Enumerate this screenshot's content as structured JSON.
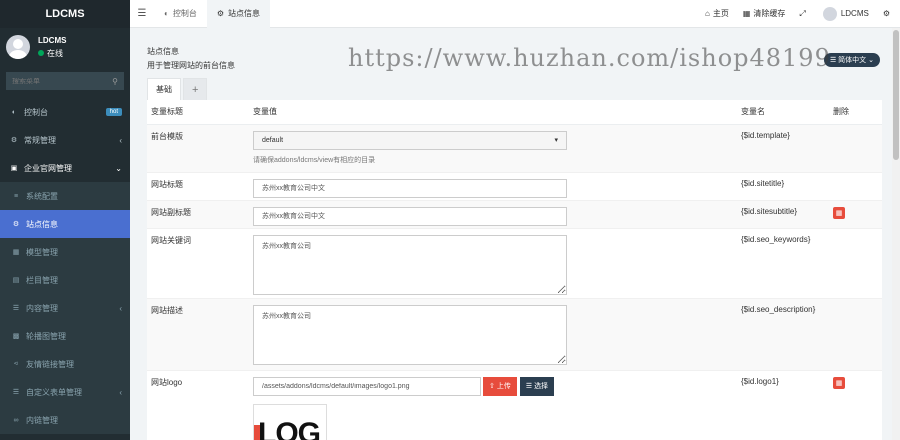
{
  "brand": "LDCMS",
  "user": {
    "name": "LDCMS",
    "status": "在线"
  },
  "search": {
    "placeholder": "搜索菜单"
  },
  "nav": {
    "dashboard": "控制台",
    "dashboard_badge": "hot",
    "general": "常规管理",
    "enterprise": "企业官网管理",
    "items": [
      "系统配置",
      "站点信息",
      "模型管理",
      "栏目管理",
      "内容管理",
      "轮播图管理",
      "友情链接管理",
      "自定义表单管理",
      "内链管理"
    ]
  },
  "topbar": {
    "tabs": [
      "控制台",
      "站点信息"
    ],
    "home": "主页",
    "clear_cache": "清除缓存",
    "username": "LDCMS"
  },
  "panel": {
    "title": "站点信息",
    "desc": "用于管理网站的前台信息",
    "lang": "简体中文",
    "tab_basic": "基础",
    "tab_add": "+"
  },
  "watermark": "https://www.huzhan.com/ishop48199",
  "table": {
    "headers": {
      "title": "变量标题",
      "value": "变量值",
      "name": "变量名",
      "delete": "删除"
    },
    "rows": [
      {
        "title": "前台模版",
        "value": "default",
        "help": "请确保addons/ldcms/view有相应的目录",
        "name": "{$id.template}"
      },
      {
        "title": "网站标题",
        "value": "苏州xx教育公司中文",
        "name": "{$id.sitetitle}"
      },
      {
        "title": "网站副标题",
        "value": "苏州xx教育公司中文",
        "name": "{$id.sitesubtitle}"
      },
      {
        "title": "网站关键词",
        "value": "苏州xx教育公司",
        "name": "{$id.seo_keywords}"
      },
      {
        "title": "网站描述",
        "value": "苏州xx教育公司",
        "name": "{$id.seo_description}"
      },
      {
        "title": "网站logo",
        "value": "/assets/addons/ldcms/default/images/logo1.png",
        "name": "{$id.logo1}",
        "upload": "上传",
        "choose": "选择",
        "preview_text": "LOG"
      }
    ]
  },
  "colors": {
    "sidebar": "#222d32",
    "active": "#4a6fd0",
    "danger": "#e74c3c",
    "dark": "#2b3e50"
  }
}
